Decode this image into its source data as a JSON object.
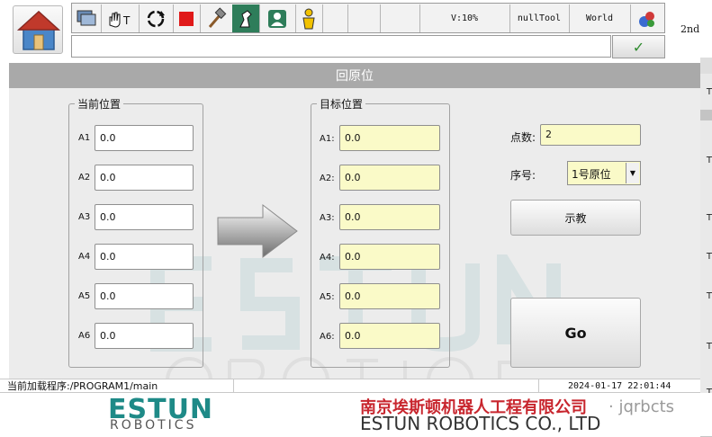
{
  "toolbar": {
    "velocity": "V:10%",
    "tool": "nullTool",
    "coord": "World"
  },
  "side": {
    "mode": "2nd",
    "tabs": [
      "T",
      "T",
      "T",
      "T",
      "T",
      "T",
      "T",
      "T"
    ]
  },
  "title": "回原位",
  "current": {
    "label": "当前位置",
    "axes": [
      {
        "name": "A1",
        "value": "0.0"
      },
      {
        "name": "A2",
        "value": "0.0"
      },
      {
        "name": "A3",
        "value": "0.0"
      },
      {
        "name": "A4",
        "value": "0.0"
      },
      {
        "name": "A5",
        "value": "0.0"
      },
      {
        "name": "A6",
        "value": "0.0"
      }
    ]
  },
  "target": {
    "label": "目标位置",
    "axes": [
      {
        "name": "A1:",
        "value": "0.0"
      },
      {
        "name": "A2:",
        "value": "0.0"
      },
      {
        "name": "A3:",
        "value": "0.0"
      },
      {
        "name": "A4:",
        "value": "0.0"
      },
      {
        "name": "A5:",
        "value": "0.0"
      },
      {
        "name": "A6:",
        "value": "0.0"
      }
    ]
  },
  "controls": {
    "points_label": "点数:",
    "points_value": "2",
    "index_label": "序号:",
    "index_value": "1号原位",
    "teach_label": "示教",
    "go_label": "Go"
  },
  "status": {
    "program": "当前加载程序:/PROGRAM1/main",
    "datetime": "2024-01-17 22:01:44"
  },
  "footer": {
    "brand": "ESTUN",
    "brand_sub": "ROBOTICS",
    "company_cn": "南京埃斯顿机器人工程有限公司",
    "company_en": "ESTUN ROBOTICS CO., LTD",
    "watermark": "jqrbcts"
  },
  "colors": {
    "brand_teal": "#1e8a87",
    "company_red": "#c8262e",
    "field_yellow": "#fafac8",
    "title_gray": "#a9a9a9"
  }
}
